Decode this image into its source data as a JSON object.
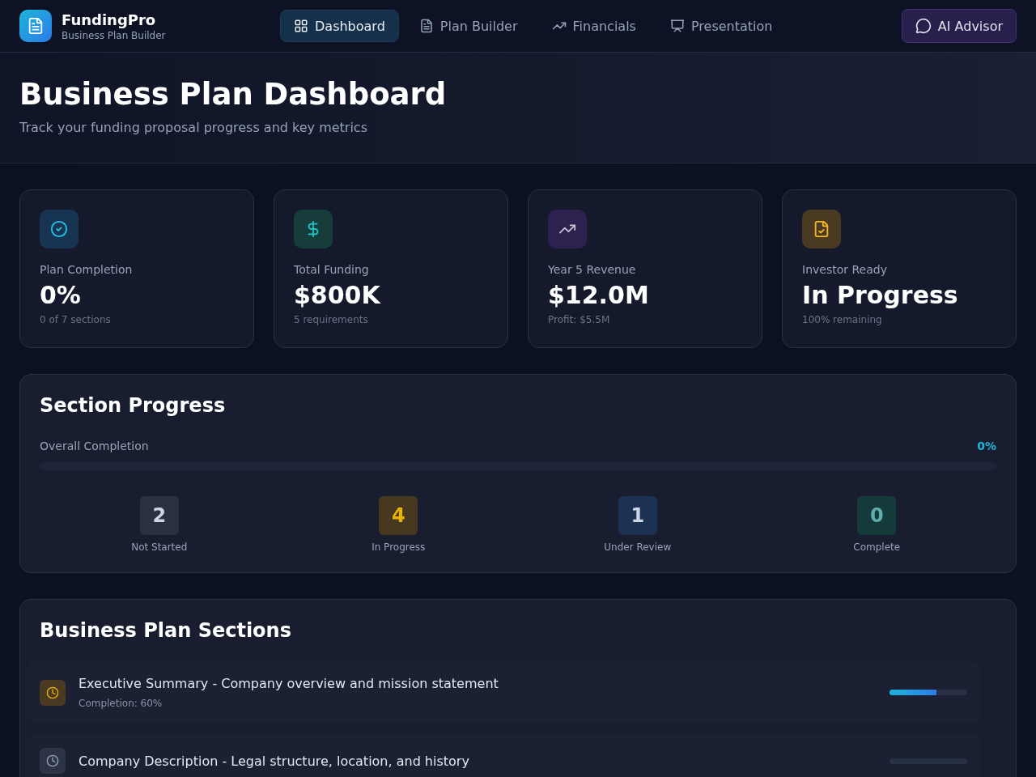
{
  "brand": {
    "name": "FundingPro",
    "tagline": "Business Plan Builder"
  },
  "nav": [
    {
      "label": "Dashboard",
      "selected": true
    },
    {
      "label": "Plan Builder",
      "selected": false
    },
    {
      "label": "Financials",
      "selected": false
    },
    {
      "label": "Presentation",
      "selected": false
    }
  ],
  "advisor_button": "AI Advisor",
  "header": {
    "title": "Business Plan Dashboard",
    "subtitle": "Track your funding proposal progress and key metrics"
  },
  "metrics": [
    {
      "label": "Plan Completion",
      "value": "0%",
      "note": "0 of 7 sections"
    },
    {
      "label": "Total Funding",
      "value": "$800K",
      "note": "5 requirements"
    },
    {
      "label": "Year 5 Revenue",
      "value": "$12.0M",
      "note": "Profit: $5.5M"
    },
    {
      "label": "Investor Ready",
      "value": "In Progress",
      "note": "100% remaining"
    }
  ],
  "section_progress": {
    "title": "Section Progress",
    "overall_label": "Overall Completion",
    "overall_value": "0%",
    "level": 0,
    "statuses": [
      {
        "kind": "not_started",
        "count": "2",
        "label": "Not Started"
      },
      {
        "kind": "in_progress",
        "count": "4",
        "label": "In Progress"
      },
      {
        "kind": "review",
        "count": "1",
        "label": "Under Review"
      },
      {
        "kind": "complete",
        "count": "0",
        "label": "Complete"
      }
    ]
  },
  "sections": {
    "title": "Business Plan Sections",
    "items": [
      {
        "kind": "in_progress",
        "title": "Executive Summary - Company overview and mission statement",
        "note": "Completion: 60%",
        "level": 0.6
      },
      {
        "kind": "not_started",
        "title": "Company Description - Legal structure, location, and history",
        "level": 0
      }
    ]
  }
}
